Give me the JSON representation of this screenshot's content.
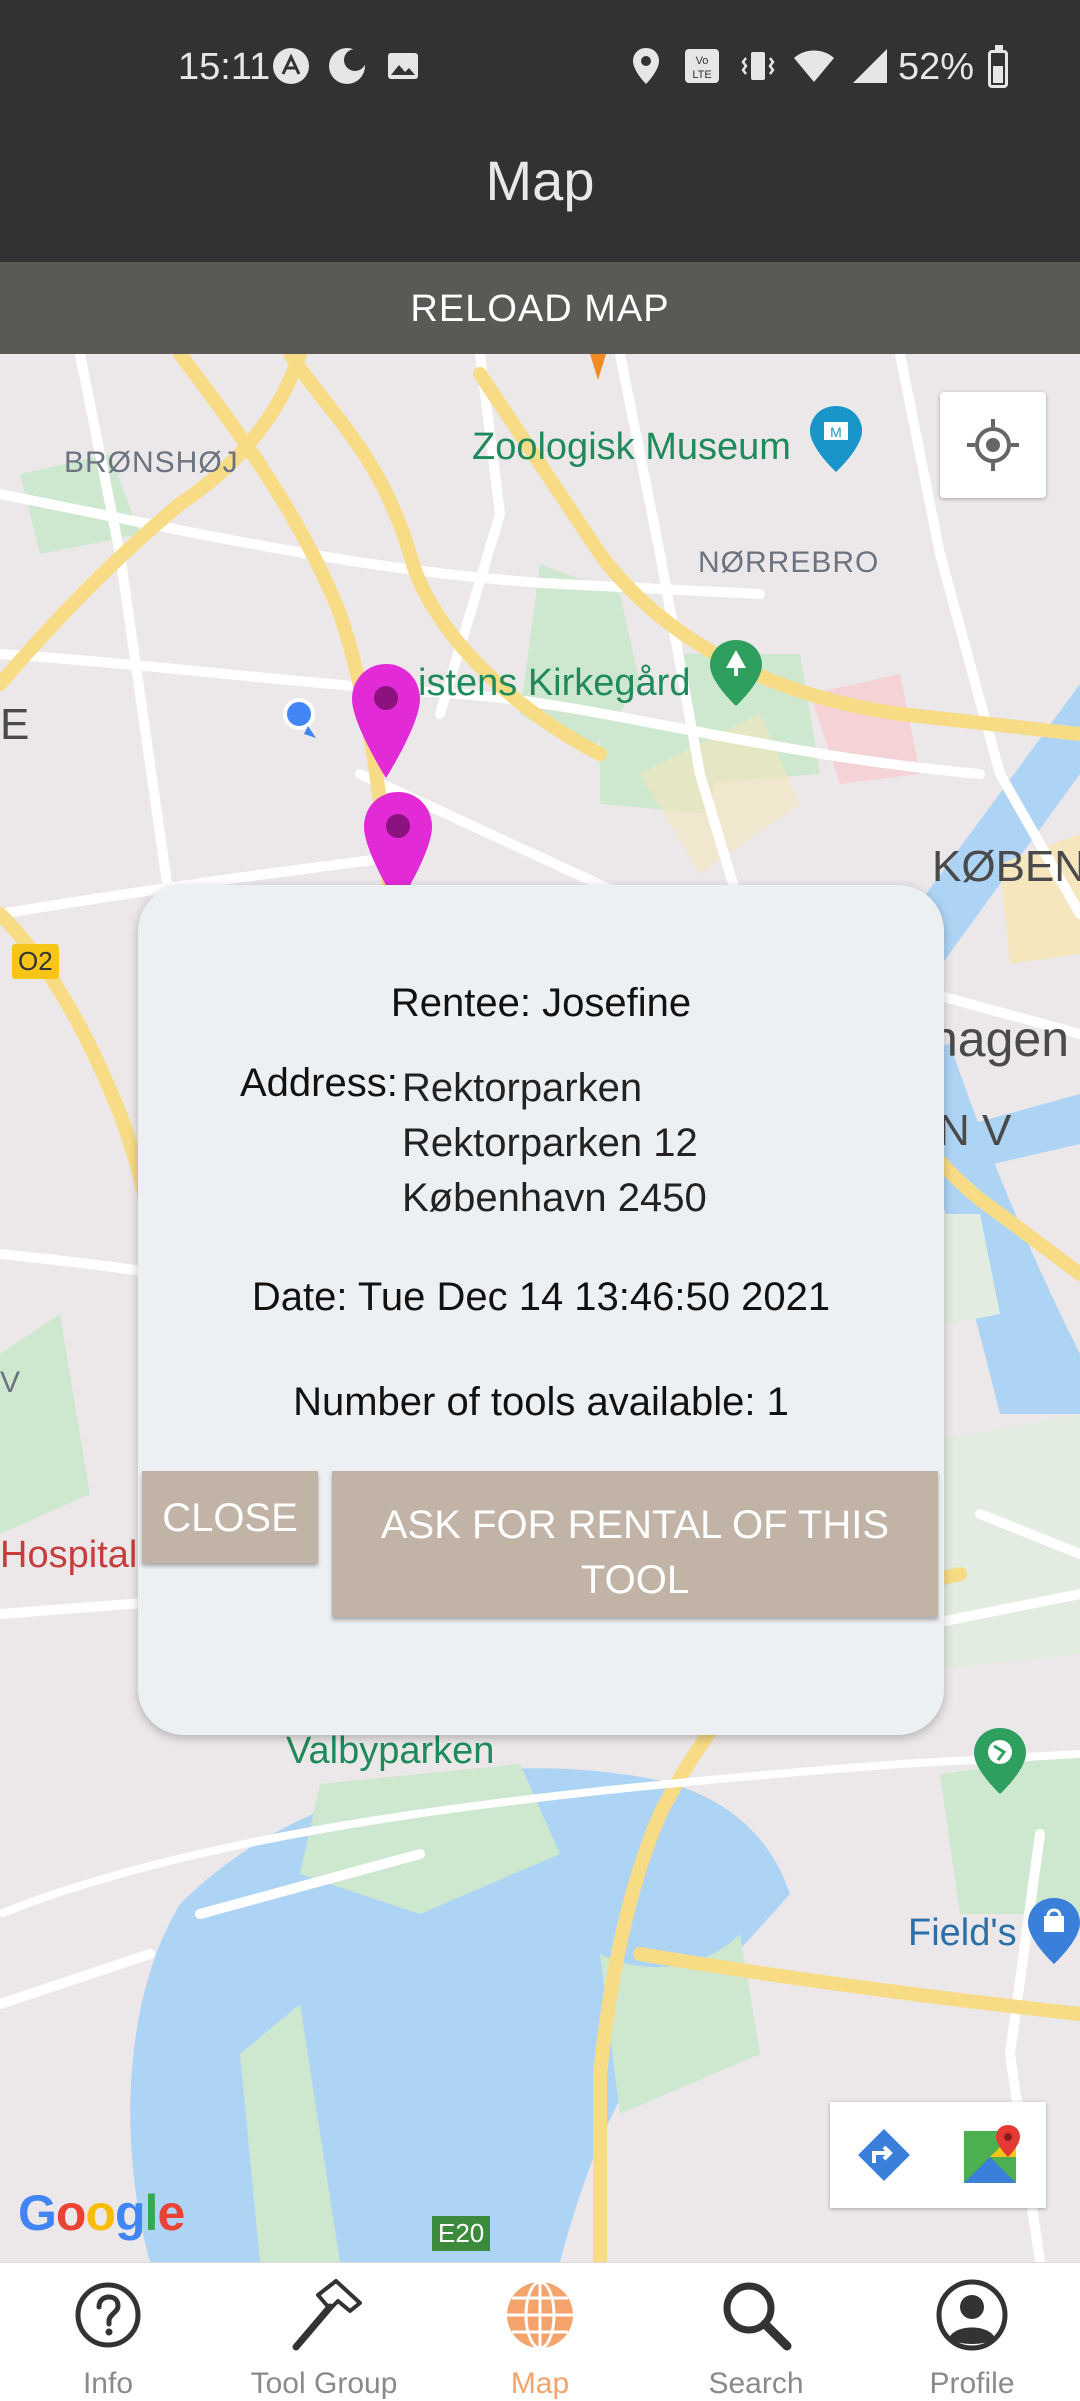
{
  "status_bar": {
    "time": "15:11",
    "battery": "52%",
    "battery_level": 0.52
  },
  "app_bar": {
    "title": "Map"
  },
  "reload_button": {
    "label": "RELOAD MAP"
  },
  "map": {
    "labels": {
      "bronshoj": "BRØNSHØJ",
      "zoologisk": "Zoologisk Museum",
      "norrebro": "NØRREBRO",
      "assistens": "istens Kirkegård",
      "edge_e": "E",
      "kobenhavn_caps": "KØBENH",
      "o2": "O2",
      "hagen": "hagen",
      "nv": "N V",
      "v_edge": "V",
      "hospital": "Hospital",
      "valbyparken": "Valbyparken",
      "fields": "Field's",
      "e20": "E20",
      "google": "Google"
    }
  },
  "dialog": {
    "rentee_label": "Rentee:",
    "rentee_name": "Josefine",
    "address_label": "Address:",
    "address_lines": [
      "Rektorparken",
      "Rektorparken 12",
      "København 2450"
    ],
    "date_label": "Date:",
    "date_value": "Tue Dec 14 13:46:50 2021",
    "tools_label": "Number of tools available:",
    "tools_value": "1",
    "close_label": "CLOSE",
    "ask_label_1": "ASK FOR RENTAL OF THIS",
    "ask_label_2": "TOOL"
  },
  "bottom_nav": {
    "items": [
      {
        "label": "Info",
        "icon": "info-icon"
      },
      {
        "label": "Tool Group",
        "icon": "hammer-icon"
      },
      {
        "label": "Map",
        "icon": "globe-icon",
        "active": true
      },
      {
        "label": "Search",
        "icon": "search-icon"
      },
      {
        "label": "Profile",
        "icon": "profile-icon"
      }
    ],
    "active_color": "#f3a36b",
    "inactive_color": "#8a8a8a"
  },
  "colors": {
    "marker": "#e22ad6",
    "appbar": "#323232",
    "button": "#c1b3a6"
  }
}
